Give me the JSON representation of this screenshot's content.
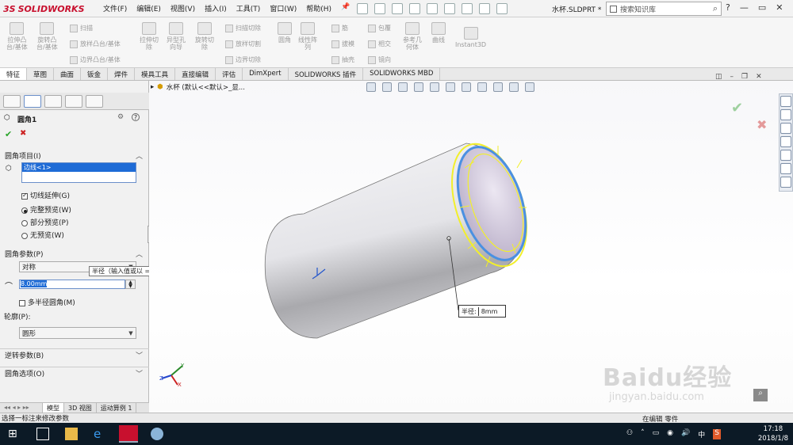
{
  "app": {
    "brand_prefix": "3S",
    "brand_name": "SOLIDWORKS"
  },
  "menu": [
    "文件(F)",
    "编辑(E)",
    "视图(V)",
    "插入(I)",
    "工具(T)",
    "窗口(W)",
    "帮助(H)"
  ],
  "document_title": "水杯.SLDPRT *",
  "search": {
    "placeholder": "搜索知识库"
  },
  "window_controls": {
    "help": "?",
    "minimize": "—",
    "restore": "▭",
    "close": "✕"
  },
  "ribbon": {
    "big": [
      {
        "label": "拉伸凸\n台/基体"
      },
      {
        "label": "旋转凸\n台/基体"
      },
      {
        "label": "拉伸切\n除"
      },
      {
        "label": "异型孔\n向导"
      },
      {
        "label": "旋转切\n除"
      },
      {
        "label": "圆角"
      },
      {
        "label": "线性阵\n列"
      },
      {
        "label": "参考几\n何体"
      },
      {
        "label": "曲线"
      },
      {
        "label": "Instant3D"
      }
    ],
    "small": [
      {
        "label": "扫描"
      },
      {
        "label": "放样凸台/基体"
      },
      {
        "label": "边界凸台/基体"
      },
      {
        "label": "扫描切除"
      },
      {
        "label": "放样切割"
      },
      {
        "label": "边界切除"
      },
      {
        "label": "筋"
      },
      {
        "label": "拔模"
      },
      {
        "label": "抽壳"
      },
      {
        "label": "包覆"
      },
      {
        "label": "相交"
      },
      {
        "label": "镜向"
      }
    ]
  },
  "tabs": [
    {
      "label": "特征",
      "active": true
    },
    {
      "label": "草图"
    },
    {
      "label": "曲面"
    },
    {
      "label": "钣金"
    },
    {
      "label": "焊件"
    },
    {
      "label": "模具工具"
    },
    {
      "label": "直接编辑"
    },
    {
      "label": "评估"
    },
    {
      "label": "DimXpert"
    },
    {
      "label": "SOLIDWORKS 插件"
    },
    {
      "label": "SOLIDWORKS MBD"
    }
  ],
  "tree_path": "水杯 (默认<<默认>_显...",
  "panel": {
    "title": "圆角1",
    "ok": "✔",
    "cancel": "✖",
    "help": "?",
    "items_section": "圆角项目(I)",
    "edge_selected": "边线<1>",
    "tangent": "切线延伸(G)",
    "full_preview": "完整预览(W)",
    "partial_preview": "部分预览(P)",
    "no_preview": "无预览(W)",
    "params_section": "圆角参数(P)",
    "symmetric": "对称",
    "tooltip": "半径（输入值或以 = 开始，以创建方程式）",
    "radius_value": "8.00mm",
    "multi_radius": "多半径圆角(M)",
    "profile_label": "轮廓(P):",
    "profile_value": "圆形",
    "setback_section": "逆转参数(B)",
    "options_section": "圆角选项(O)"
  },
  "callout": {
    "label": "半径:",
    "value": "8mm"
  },
  "bottom_tabs": [
    {
      "label": "模型",
      "active": true
    },
    {
      "label": "3D 视图"
    },
    {
      "label": "运动算例 1"
    }
  ],
  "status_text": "选择一标注来修改参数",
  "status_right": "在编辑 零件",
  "watermark": {
    "line1": "Baidu经验",
    "line2": "jingyan.baidu.com"
  },
  "taskbar": {
    "time": "17:18",
    "date": "2018/1/8",
    "ime": "中"
  },
  "colors": {
    "selection": "#1e6bd6",
    "edge_highlight": "#4a90e2",
    "fillet_preview": "#f2ef2a",
    "ok_green": "#2aa52a",
    "cancel_red": "#cc2222"
  }
}
